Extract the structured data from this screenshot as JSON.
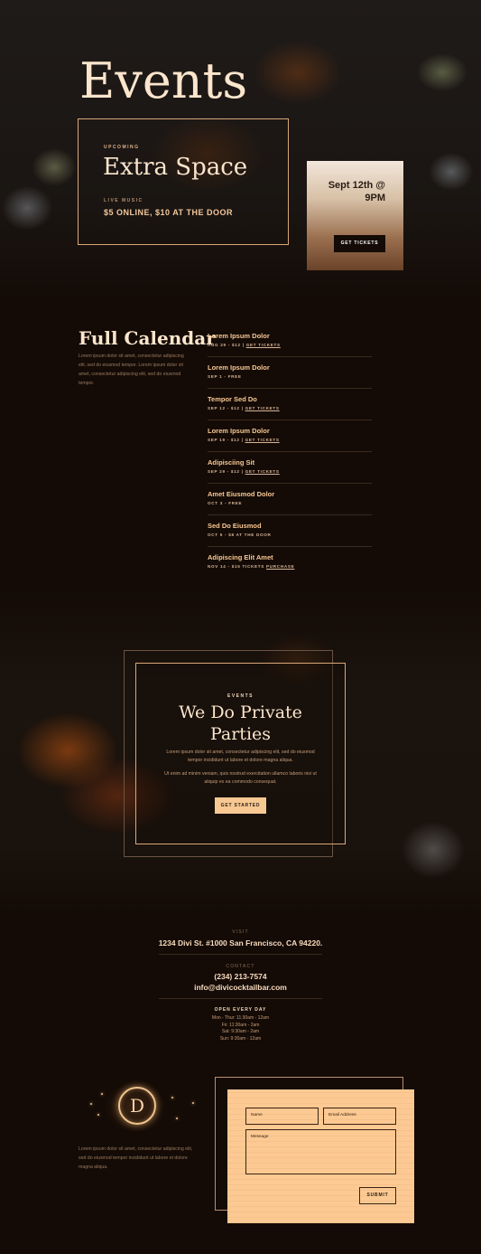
{
  "hero": {
    "title": "Events",
    "featured": {
      "eyebrow": "UPCOMING",
      "name": "Extra Space",
      "category": "LIVE MUSIC",
      "price": "$5 ONLINE, $10 AT THE DOOR"
    },
    "date_card": {
      "date_line1": "Sept 12th @",
      "date_line2": "9PM",
      "button": "GET TICKETS"
    }
  },
  "calendar": {
    "title": "Full Calendar",
    "description": "Lorem ipsum dolor sit amet, consectetur adipiscing elit, sed do eiusmod tempor. Lorem ipsum dolor sit amet, consectetur adipiscing elit, sed do eiusmod tempor.",
    "events": [
      {
        "name": "Lorem Ipsum Dolor",
        "details": "AUG 29 - $12 | ",
        "link": "GET TICKETS"
      },
      {
        "name": "Lorem Ipsum Dolor",
        "details": "SEP 1 - FREE",
        "link": ""
      },
      {
        "name": "Tempor Sed Do",
        "details": "SEP 12 - $12 | ",
        "link": "GET TICKETS"
      },
      {
        "name": "Lorem Ipsum Dolor",
        "details": "SEP 19 - $12 | ",
        "link": "GET TICKETS"
      },
      {
        "name": "Adipisciing Sit",
        "details": "SEP 29 - $12 | ",
        "link": "GET TICKETS"
      },
      {
        "name": "Amet Eiusmod Dolor",
        "details": "OCT 3 - FREE",
        "link": ""
      },
      {
        "name": "Sed Do Eiusmod",
        "details": "OCT 5 - $8 AT THE DOOR",
        "link": ""
      },
      {
        "name": "Adipiscing Elit Amet",
        "details": "NOV 14 - $15 TICKETS ",
        "link": "PURCHASE"
      }
    ]
  },
  "private_parties": {
    "eyebrow": "EVENTS",
    "title_line1": "We Do Private",
    "title_line2": "Parties",
    "text1": "Lorem ipsum dolor sit amet, consectetur adipiscing elit, sed do eiusmod tempor incididunt ut labore et dolore magna aliqua.",
    "text2": "Ut enim ad minim veniam, quis nostrud exercitation ullamco laboris nisi ut aliquip ex ea commodo consequat.",
    "button": "GET STARTED"
  },
  "contact": {
    "visit_label": "VISIT",
    "address": "1234 Divi St. #1000 San Francisco, CA 94220.",
    "contact_label": "CONTACT",
    "phone": "(234) 213-7574",
    "email": "info@divicocktailbar.com",
    "hours_label": "OPEN EVERY DAY",
    "hours": [
      "Mon - Thur: 11:30am - 12am",
      "Fri: 11:30am - 2am",
      "Sat: 9:30am - 2am",
      "Sun: 9:30am - 12am"
    ]
  },
  "footer": {
    "logo_letter": "D",
    "description": "Lorem ipsum dolor sit amet, consectetur adipiscing elit, sed do eiusmod tempor incididunt ut labore et dolore magna aliqua.",
    "form": {
      "name_placeholder": "Name",
      "email_placeholder": "Email Address",
      "message_placeholder": "Message",
      "submit": "SUBMIT"
    }
  },
  "colors": {
    "background": "#140b06",
    "accent": "#f8c893",
    "heading": "#fbe5cc",
    "form_card": "#fcc993"
  }
}
